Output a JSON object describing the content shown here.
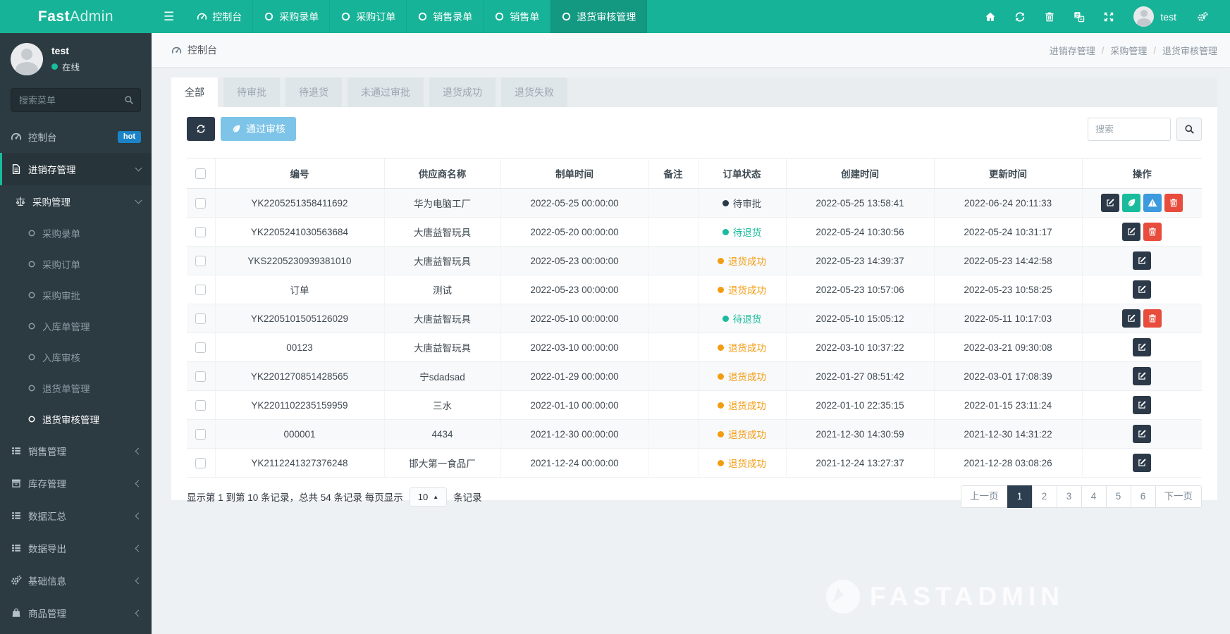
{
  "brand": {
    "name_bold": "Fast",
    "name_light": "Admin"
  },
  "colors": {
    "topbar_teal": "#17b398",
    "badge_hot_blue": "#1c84c6",
    "success_teal": "#18bc9c",
    "warning_orange": "#f39c12",
    "danger_red": "#e74c3c",
    "info_light_blue": "#7dc4e8",
    "dark_navy": "#2b3948",
    "pagination_active": "#2c3e50"
  },
  "topnav": {
    "tabs": [
      {
        "label": "控制台",
        "icon": "gauge",
        "active": false
      },
      {
        "label": "采购录单",
        "icon": "circle",
        "active": false
      },
      {
        "label": "采购订单",
        "icon": "circle",
        "active": false
      },
      {
        "label": "销售录单",
        "icon": "circle",
        "active": false
      },
      {
        "label": "销售单",
        "icon": "circle",
        "active": false
      },
      {
        "label": "退货审核管理",
        "icon": "circle",
        "active": true
      }
    ],
    "right_icons": [
      "home",
      "refresh",
      "trash",
      "translate",
      "fullscreen"
    ],
    "username": "test"
  },
  "sidebar": {
    "user": {
      "name": "test",
      "status": "在线"
    },
    "search_placeholder": "搜索菜单",
    "menu": [
      {
        "label": "控制台",
        "icon": "gauge",
        "level": 1,
        "badge": "hot"
      },
      {
        "label": "进销存管理",
        "icon": "file",
        "level": 1,
        "chevron": "down",
        "active": true
      },
      {
        "label": "采购管理",
        "icon": "balance",
        "level": 2,
        "chevron": "down"
      },
      {
        "label": "采购录单",
        "icon": "circle",
        "level": 3
      },
      {
        "label": "采购订单",
        "icon": "circle",
        "level": 3
      },
      {
        "label": "采购审批",
        "icon": "circle",
        "level": 3
      },
      {
        "label": "入库单管理",
        "icon": "circle",
        "level": 3
      },
      {
        "label": "入库审核",
        "icon": "circle",
        "level": 3
      },
      {
        "label": "退货单管理",
        "icon": "circle",
        "level": 3
      },
      {
        "label": "退货审核管理",
        "icon": "circle",
        "level": 3,
        "active": true
      },
      {
        "label": "销售管理",
        "icon": "list",
        "level": 1,
        "chevron": "left"
      },
      {
        "label": "库存管理",
        "icon": "window",
        "level": 1,
        "chevron": "left"
      },
      {
        "label": "数据汇总",
        "icon": "list",
        "level": 1,
        "chevron": "left"
      },
      {
        "label": "数据导出",
        "icon": "list",
        "level": 1,
        "chevron": "left"
      },
      {
        "label": "基础信息",
        "icon": "cogs",
        "level": 1,
        "chevron": "left"
      },
      {
        "label": "商品管理",
        "icon": "bag",
        "level": 1,
        "chevron": "left"
      }
    ]
  },
  "breadcrumb": {
    "page": "控制台",
    "trail": [
      "进销存管理",
      "采购管理",
      "退货审核管理"
    ]
  },
  "filters": {
    "tabs": [
      {
        "label": "全部",
        "active": true
      },
      {
        "label": "待审批",
        "active": false
      },
      {
        "label": "待退货",
        "active": false
      },
      {
        "label": "未通过审批",
        "active": false
      },
      {
        "label": "退货成功",
        "active": false
      },
      {
        "label": "退货失败",
        "active": false
      }
    ]
  },
  "toolbar": {
    "approve_label": "通过审核",
    "search_placeholder": "搜索"
  },
  "table": {
    "columns": [
      "编号",
      "供应商名称",
      "制单时间",
      "备注",
      "订单状态",
      "创建时间",
      "更新时间",
      "操作"
    ],
    "status_styles": {
      "待审批": {
        "dot": "#2b3948",
        "text": "#46505a"
      },
      "待退货": {
        "dot": "#18bc9c",
        "text": "#18bc9c"
      },
      "退货成功": {
        "dot": "#f39c12",
        "text": "#f39c12"
      }
    },
    "rows": [
      {
        "code": "YK2205251358411692",
        "supplier": "华为电脑工厂",
        "order_time": "2022-05-25 00:00:00",
        "remark": "",
        "status": "待审批",
        "created": "2022-05-25 13:58:41",
        "updated": "2022-06-24 20:11:33",
        "actions": [
          "edit",
          "pass",
          "warn",
          "delete"
        ]
      },
      {
        "code": "YK2205241030563684",
        "supplier": "大唐益智玩具",
        "order_time": "2022-05-20 00:00:00",
        "remark": "",
        "status": "待退货",
        "created": "2022-05-24 10:30:56",
        "updated": "2022-05-24 10:31:17",
        "actions": [
          "edit",
          "delete"
        ]
      },
      {
        "code": "YKS2205230939381010",
        "supplier": "大唐益智玩具",
        "order_time": "2022-05-23 00:00:00",
        "remark": "",
        "status": "退货成功",
        "created": "2022-05-23 14:39:37",
        "updated": "2022-05-23 14:42:58",
        "actions": [
          "edit"
        ]
      },
      {
        "code": "订单",
        "supplier": "测试",
        "order_time": "2022-05-23 00:00:00",
        "remark": "",
        "status": "退货成功",
        "created": "2022-05-23 10:57:06",
        "updated": "2022-05-23 10:58:25",
        "actions": [
          "edit"
        ]
      },
      {
        "code": "YK2205101505126029",
        "supplier": "大唐益智玩具",
        "order_time": "2022-05-10 00:00:00",
        "remark": "",
        "status": "待退货",
        "created": "2022-05-10 15:05:12",
        "updated": "2022-05-11 10:17:03",
        "actions": [
          "edit",
          "delete"
        ]
      },
      {
        "code": "00123",
        "supplier": "大唐益智玩具",
        "order_time": "2022-03-10 00:00:00",
        "remark": "",
        "status": "退货成功",
        "created": "2022-03-10 10:37:22",
        "updated": "2022-03-21 09:30:08",
        "actions": [
          "edit"
        ]
      },
      {
        "code": "YK2201270851428565",
        "supplier": "宁sdadsad",
        "order_time": "2022-01-29 00:00:00",
        "remark": "",
        "status": "退货成功",
        "created": "2022-01-27 08:51:42",
        "updated": "2022-03-01 17:08:39",
        "actions": [
          "edit"
        ]
      },
      {
        "code": "YK2201102235159959",
        "supplier": "三水",
        "order_time": "2022-01-10 00:00:00",
        "remark": "",
        "status": "退货成功",
        "created": "2022-01-10 22:35:15",
        "updated": "2022-01-15 23:11:24",
        "actions": [
          "edit"
        ]
      },
      {
        "code": "000001",
        "supplier": "4434",
        "order_time": "2021-12-30 00:00:00",
        "remark": "",
        "status": "退货成功",
        "created": "2021-12-30 14:30:59",
        "updated": "2021-12-30 14:31:22",
        "actions": [
          "edit"
        ]
      },
      {
        "code": "YK2112241327376248",
        "supplier": "邯大第一食品厂",
        "order_time": "2021-12-24 00:00:00",
        "remark": "",
        "status": "退货成功",
        "created": "2021-12-24 13:27:37",
        "updated": "2021-12-28 03:08:26",
        "actions": [
          "edit"
        ]
      }
    ]
  },
  "pagination": {
    "info_prefix": "显示第 1 到第 10 条记录，总共 54 条记录 每页显示",
    "per_page": "10",
    "info_suffix": "条记录",
    "prev": "上一页",
    "next": "下一页",
    "pages": [
      "1",
      "2",
      "3",
      "4",
      "5",
      "6"
    ],
    "active_page": "1"
  },
  "watermark": {
    "text": "FASTADMIN"
  }
}
